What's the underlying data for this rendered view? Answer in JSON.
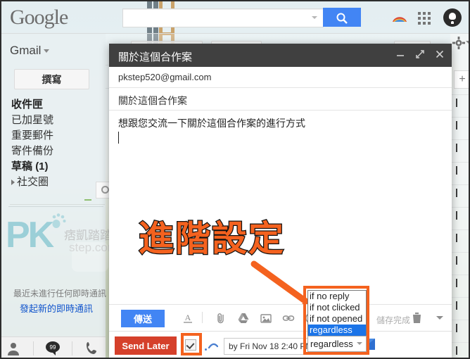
{
  "topbar": {
    "logo": "Google",
    "search_value": "",
    "search_placeholder": "",
    "search_icon": "search-icon",
    "gplus_icon": "google-plus-icon",
    "apps_icon": "apps-grid-icon",
    "notification_icon": "notification-bell-icon"
  },
  "sidebar": {
    "menu_label": "Gmail",
    "compose_label": "撰寫",
    "items": [
      {
        "label": "收件匣",
        "bold": true,
        "count": ""
      },
      {
        "label": "已加星號",
        "bold": false,
        "count": ""
      },
      {
        "label": "重要郵件",
        "bold": false,
        "count": ""
      },
      {
        "label": "寄件備份",
        "bold": false,
        "count": ""
      },
      {
        "label": "草稿",
        "bold": true,
        "count": "(1)"
      },
      {
        "label": "社交圈",
        "bold": false,
        "count": "",
        "expandable": true
      }
    ],
    "chat_note": "最近未進行任何即時通訊",
    "chat_link": "發起新的即時通訊",
    "watermark": {
      "initials": "PK",
      "cn": "痞凱踏踏",
      "domain": "step.com"
    },
    "chat_icons": [
      "person-icon",
      "chat-bubble-icon",
      "phone-icon"
    ]
  },
  "rightpanel": {
    "gear_icon": "gear-icon",
    "plus_label": "+"
  },
  "compose": {
    "title": "關於這個合作案",
    "minimize_icon": "minimize-icon",
    "expand_icon": "expand-icon",
    "close_icon": "close-icon",
    "to": "pkstep520@gmail.com",
    "subject": "關於這個合作案",
    "body": "想跟您交流一下關於這個合作案的進行方式",
    "send_label": "傳送",
    "saved_status": "儲存完成",
    "toolbar_icons": [
      "format-text-icon",
      "attach-file-icon",
      "google-drive-icon",
      "insert-photo-icon",
      "insert-link-icon",
      "insert-emoji-icon"
    ],
    "trash_icon": "trash-icon",
    "more-options-icon": "more-options-caret-icon"
  },
  "annotation": {
    "text": "進階設定",
    "color": "#f4621f",
    "outline": "#111111",
    "arrow_icon": "arrow-down-right-icon",
    "highlight_color": "#f4621f"
  },
  "boomerang": {
    "send_later_label": "Send Later",
    "checkbox_checked": true,
    "date_label": "by Fri Nov 18 2:40 PM",
    "help_icon": "boomerang-help-envelope-icon",
    "condition_select": {
      "selected": "regardless",
      "options": [
        "if no reply",
        "if not clicked",
        "if not opened",
        "regardless"
      ]
    }
  }
}
